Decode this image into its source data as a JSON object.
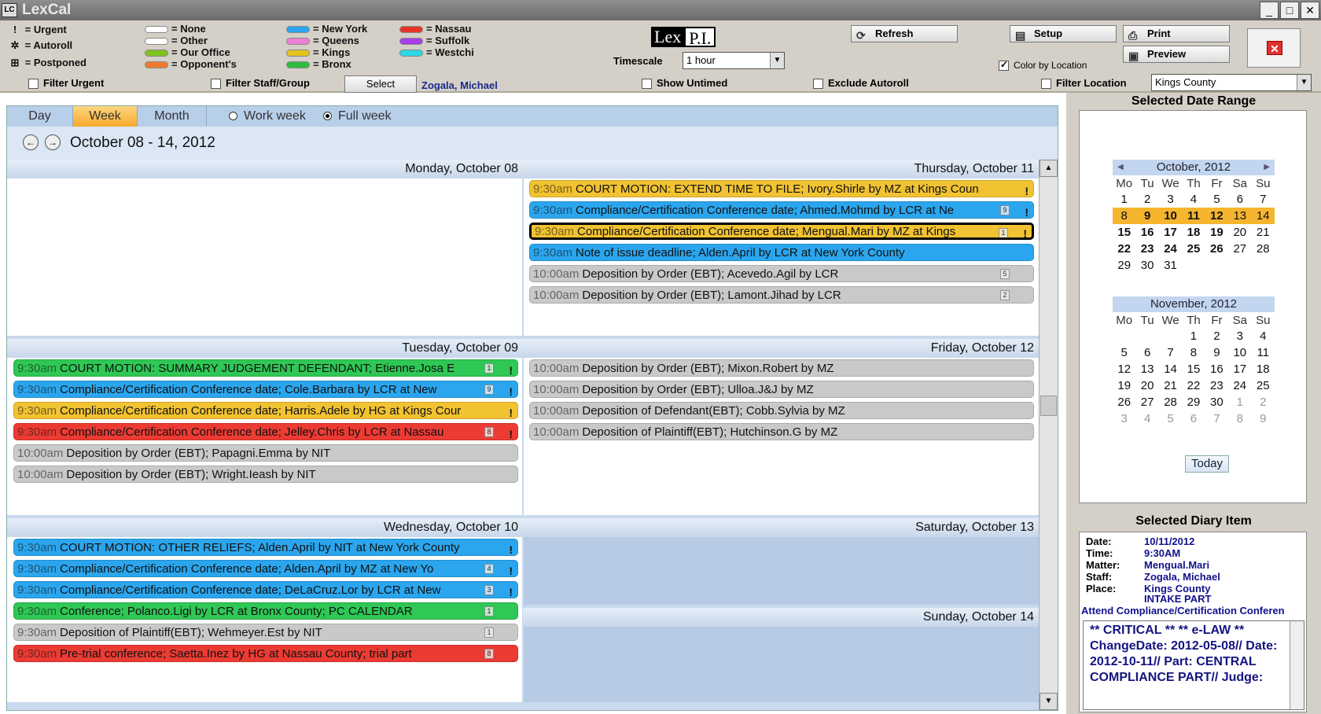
{
  "window": {
    "title": "LexCal",
    "min": "_",
    "max": "□",
    "close": "✕"
  },
  "legend": {
    "symbols": [
      {
        "label": "= Urgent",
        "icon": "urgent-icon",
        "glyph": "!"
      },
      {
        "label": "= Autoroll",
        "icon": "autoroll-icon",
        "glyph": "✲"
      },
      {
        "label": "= Postponed",
        "icon": "postponed-icon",
        "glyph": "⊞"
      }
    ],
    "col1": [
      {
        "label": "= None",
        "color": "#ffffff"
      },
      {
        "label": "= Other",
        "color": "#ffffff"
      },
      {
        "label": "= Our Office",
        "color": "#7fc31c"
      },
      {
        "label": "= Opponent's",
        "color": "#f07b30"
      }
    ],
    "col2": [
      {
        "label": "= New York",
        "color": "#2ba6ee"
      },
      {
        "label": "= Queens",
        "color": "#f07fd4"
      },
      {
        "label": "= Kings",
        "color": "#e6c21c"
      },
      {
        "label": "= Bronx",
        "color": "#2fbd3f"
      }
    ],
    "col3": [
      {
        "label": "= Nassau",
        "color": "#e5352a"
      },
      {
        "label": "= Suffolk",
        "color": "#a63fe6"
      },
      {
        "label": "= Westchi",
        "color": "#2bd7e6"
      }
    ]
  },
  "toolbar": {
    "filter_urgent": "Filter Urgent",
    "filter_staff": "Filter Staff/Group",
    "select_label": "Select",
    "staff_name": "Zogala, Michael",
    "logo_a": "Lex",
    "logo_b": "P.I.",
    "timescale_label": "Timescale",
    "timescale_value": "1 hour",
    "show_untimed": "Show Untimed",
    "exclude_autoroll": "Exclude Autoroll",
    "refresh": "Refresh",
    "setup": "Setup",
    "print": "Print",
    "preview": "Preview",
    "color_by_location": "Color by Location",
    "filter_location": "Filter Location",
    "location_value": "Kings County"
  },
  "tabs": {
    "day": "Day",
    "week": "Week",
    "month": "Month",
    "work_week": "Work week",
    "full_week": "Full week"
  },
  "range_text": "October 08 - 14, 2012",
  "days": {
    "mon": "Monday, October 08",
    "tue": "Tuesday, October 09",
    "wed": "Wednesday, October 10",
    "thu": "Thursday, October 11",
    "fri": "Friday, October 12",
    "sat": "Saturday, October 13",
    "sun": "Sunday, October 14"
  },
  "events": {
    "thu": [
      {
        "time": "9:30am",
        "text": "COURT MOTION: EXTEND TIME TO FILE; Ivory.Shirle by MZ at Kings Coun",
        "color": "gold",
        "num": "",
        "flag": "!"
      },
      {
        "time": "9:30am",
        "text": "Compliance/Certification Conference date; Ahmed.Mohmd by LCR at Ne",
        "color": "blue",
        "num": "9",
        "flag": "!"
      },
      {
        "time": "9:30am",
        "text": "Compliance/Certification Conference date; Mengual.Mari by MZ at Kings",
        "color": "gold",
        "num": "1",
        "flag": "!",
        "selected": true
      },
      {
        "time": "9:30am",
        "text": "Note of issue deadline; Alden.April by LCR at New York County",
        "color": "blue",
        "num": "",
        "flag": ""
      },
      {
        "time": "10:00am",
        "text": "Deposition by Order (EBT); Acevedo.Agil by LCR",
        "color": "gray",
        "num": "5",
        "flag": ""
      },
      {
        "time": "10:00am",
        "text": "Deposition by Order (EBT); Lamont.Jihad by LCR",
        "color": "gray",
        "num": "2",
        "flag": ""
      }
    ],
    "tue": [
      {
        "time": "9:30am",
        "text": "COURT MOTION: SUMMARY JUDGEMENT DEFENDANT; Etienne.Josa E",
        "color": "green",
        "num": "1",
        "flag": "!"
      },
      {
        "time": "9:30am",
        "text": "Compliance/Certification Conference date; Cole.Barbara by LCR at New",
        "color": "blue",
        "num": "9",
        "flag": "!"
      },
      {
        "time": "9:30am",
        "text": "Compliance/Certification Conference date; Harris.Adele by HG at Kings Cour",
        "color": "gold",
        "num": "",
        "flag": "!"
      },
      {
        "time": "9:30am",
        "text": "Compliance/Certification Conference date; Jelley.Chris by LCR at Nassau",
        "color": "red",
        "num": "8",
        "flag": "!"
      },
      {
        "time": "10:00am",
        "text": "Deposition by Order (EBT); Papagni.Emma by NIT",
        "color": "gray",
        "num": "",
        "flag": ""
      },
      {
        "time": "10:00am",
        "text": "Deposition by Order (EBT); Wright.Ieash by NIT",
        "color": "gray",
        "num": "",
        "flag": ""
      }
    ],
    "fri": [
      {
        "time": "10:00am",
        "text": "Deposition by Order (EBT); Mixon.Robert by MZ",
        "color": "gray",
        "num": "",
        "flag": ""
      },
      {
        "time": "10:00am",
        "text": "Deposition by Order (EBT); Ulloa.J&J by MZ",
        "color": "gray",
        "num": "",
        "flag": ""
      },
      {
        "time": "10:00am",
        "text": "Deposition of Defendant(EBT); Cobb.Sylvia by MZ",
        "color": "gray",
        "num": "",
        "flag": ""
      },
      {
        "time": "10:00am",
        "text": "Deposition of Plaintiff(EBT); Hutchinson.G by MZ",
        "color": "gray",
        "num": "",
        "flag": ""
      }
    ],
    "wed": [
      {
        "time": "9:30am",
        "text": "COURT MOTION: OTHER RELIEFS; Alden.April by NIT at New York County",
        "color": "blue",
        "num": "",
        "flag": "!"
      },
      {
        "time": "9:30am",
        "text": "Compliance/Certification Conference date; Alden.April by MZ at New Yo",
        "color": "blue",
        "num": "4",
        "flag": "!"
      },
      {
        "time": "9:30am",
        "text": "Compliance/Certification Conference date; DeLaCruz.Lor by LCR at New",
        "color": "blue",
        "num": "3",
        "flag": "!"
      },
      {
        "time": "9:30am",
        "text": "Conference; Polanco.Ligi by LCR at Bronx County; PC CALENDAR",
        "color": "green",
        "num": "1",
        "flag": ""
      },
      {
        "time": "9:30am",
        "text": "Deposition of Plaintiff(EBT); Wehmeyer.Est by NIT",
        "color": "gray",
        "num": "1",
        "flag": ""
      },
      {
        "time": "9:30am",
        "text": "Pre-trial conference; Saetta.Inez by HG at Nassau County; trial part",
        "color": "red",
        "num": "8",
        "flag": ""
      }
    ]
  },
  "right_panel": {
    "range_title": "Selected Date Range",
    "oct": {
      "title": "October, 2012",
      "dow": [
        "Mo",
        "Tu",
        "We",
        "Th",
        "Fr",
        "Sa",
        "Su"
      ],
      "weeks": [
        [
          "1",
          "2",
          "3",
          "4",
          "5",
          "6",
          "7"
        ],
        [
          "8",
          "9",
          "10",
          "11",
          "12",
          "13",
          "14"
        ],
        [
          "15",
          "16",
          "17",
          "18",
          "19",
          "20",
          "21"
        ],
        [
          "22",
          "23",
          "24",
          "25",
          "26",
          "27",
          "28"
        ],
        [
          "29",
          "30",
          "31",
          "",
          "",
          "",
          ""
        ]
      ]
    },
    "nov": {
      "title": "November, 2012",
      "dow": [
        "Mo",
        "Tu",
        "We",
        "Th",
        "Fr",
        "Sa",
        "Su"
      ],
      "weeks": [
        [
          "",
          "",
          "",
          "1",
          "2",
          "3",
          "4"
        ],
        [
          "5",
          "6",
          "7",
          "8",
          "9",
          "10",
          "11"
        ],
        [
          "12",
          "13",
          "14",
          "15",
          "16",
          "17",
          "18"
        ],
        [
          "19",
          "20",
          "21",
          "22",
          "23",
          "24",
          "25"
        ],
        [
          "26",
          "27",
          "28",
          "29",
          "30",
          "1",
          "2"
        ],
        [
          "3",
          "4",
          "5",
          "6",
          "7",
          "8",
          "9"
        ]
      ]
    },
    "today": "Today",
    "diary_title": "Selected Diary Item",
    "diary": {
      "date_k": "Date:",
      "date_v": "10/11/2012",
      "time_k": "Time:",
      "time_v": "9:30AM",
      "matter_k": "Matter:",
      "matter_v": "Mengual.Mari",
      "staff_k": "Staff:",
      "staff_v": "Zogala, Michael",
      "place_k": "Place:",
      "place_v": "Kings County",
      "place2_v": "INTAKE PART",
      "desc": "Attend Compliance/Certification Conferen",
      "memo": "** CRITICAL ** ** e-LAW ** ChangeDate: 2012-05-08// Date: 2012-10-11// Part: CENTRAL COMPLIANCE PART// Judge:"
    }
  }
}
